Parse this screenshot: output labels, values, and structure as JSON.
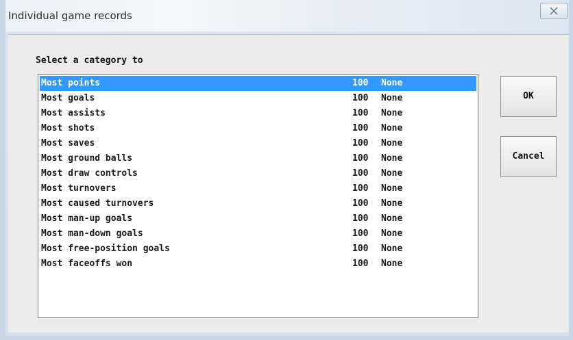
{
  "window": {
    "title": "Individual game records"
  },
  "dialog": {
    "prompt": "Select a category to",
    "ok_label": "OK",
    "cancel_label": "Cancel",
    "selected_index": 0,
    "selection_color": "#3399ff"
  },
  "list": {
    "items": [
      {
        "name": "Most points",
        "value": "100",
        "holder": "None"
      },
      {
        "name": "Most goals",
        "value": "100",
        "holder": "None"
      },
      {
        "name": "Most assists",
        "value": "100",
        "holder": "None"
      },
      {
        "name": "Most shots",
        "value": "100",
        "holder": "None"
      },
      {
        "name": "Most saves",
        "value": "100",
        "holder": "None"
      },
      {
        "name": "Most ground balls",
        "value": "100",
        "holder": "None"
      },
      {
        "name": "Most draw controls",
        "value": "100",
        "holder": "None"
      },
      {
        "name": "Most turnovers",
        "value": "100",
        "holder": "None"
      },
      {
        "name": "Most caused turnovers",
        "value": "100",
        "holder": "None"
      },
      {
        "name": "Most man-up goals",
        "value": "100",
        "holder": "None"
      },
      {
        "name": "Most man-down goals",
        "value": "100",
        "holder": "None"
      },
      {
        "name": "Most free-position goals",
        "value": "100",
        "holder": "None"
      },
      {
        "name": "Most faceoffs won",
        "value": "100",
        "holder": "None"
      }
    ]
  }
}
